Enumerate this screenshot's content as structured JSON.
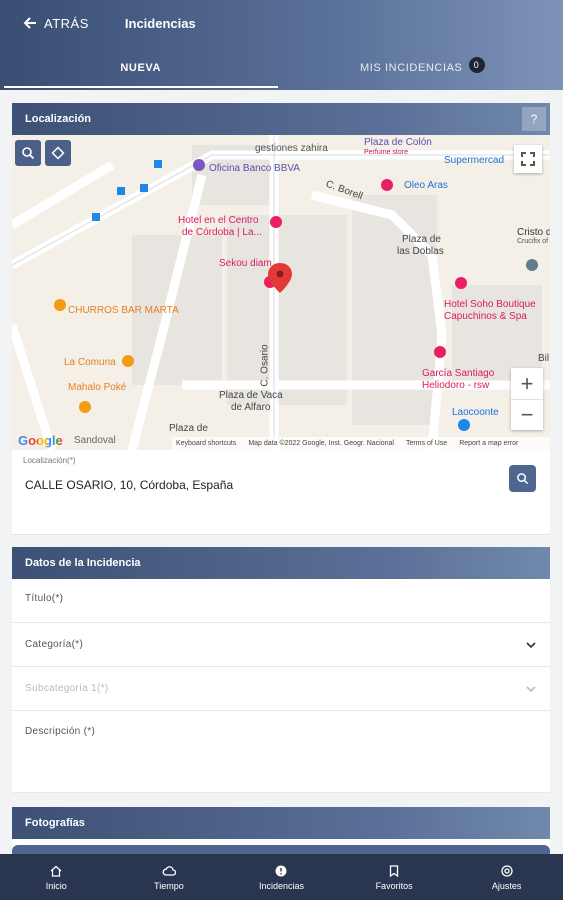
{
  "header": {
    "back_label": "ATRÁS",
    "title": "Incidencias",
    "tabs": [
      {
        "label": "NUEVA",
        "active": true
      },
      {
        "label": "MIS INCIDENCIAS",
        "badge": "0",
        "active": false
      }
    ]
  },
  "location": {
    "section_title": "Localización",
    "help_label": "?",
    "field_label": "Localización(*)",
    "field_value": "CALLE OSARIO, 10, Córdoba, España"
  },
  "map": {
    "labels": {
      "gestiones": "gestiones zahira",
      "plaza_colon": "Plaza de Colón",
      "perfume": "Perfume store",
      "supermercado": "Supermercad",
      "oficina": "Oficina Banco BBVA",
      "borell": "C. Borell",
      "oleo": "Oleo Aras",
      "hotel_centro1": "Hotel en el Centro",
      "hotel_centro2": "de Córdoba | La...",
      "plaza_doblas1": "Plaza de",
      "plaza_doblas2": "las Doblas",
      "cristo1": "Cristo d",
      "cristo2": "Crucifix of",
      "sekou": "Sekou diam",
      "churros": "CHURROS BAR MARTA",
      "hotel_soho1": "Hotel Soho Boutique",
      "hotel_soho2": "Capuchinos & Spa",
      "osario": "C. Osario",
      "comuna": "La Comuna",
      "garcia1": "García Santiago",
      "garcia2": "Heliodoro - rsw",
      "mahalo": "Mahalo Poké",
      "vaca1": "Plaza de Vaca",
      "vaca2": "de Alfaro",
      "laocoonte": "Laocoonte",
      "plaza_bottom": "Plaza de",
      "sandoval": "Sandoval",
      "bil": "Bil"
    },
    "google": "Google",
    "footer": {
      "shortcuts": "Keyboard shortcuts",
      "mapdata": "Map data ©2022 Google, Inst. Geogr. Nacional",
      "terms": "Terms of Use",
      "report": "Report a map error"
    },
    "zoom_in": "+",
    "zoom_out": "−"
  },
  "datos": {
    "section_title": "Datos de la Incidencia",
    "titulo": "Título(*)",
    "categoria": "Categoría(*)",
    "subcategoria": "Subcategoría 1(*)",
    "descripcion": "Descripción (*)"
  },
  "fotos": {
    "section_title": "Fotografías"
  },
  "nav": [
    {
      "label": "Inicio",
      "icon": "home-icon"
    },
    {
      "label": "Tiempo",
      "icon": "cloud-icon"
    },
    {
      "label": "Incidencias",
      "icon": "alert-icon"
    },
    {
      "label": "Favoritos",
      "icon": "bookmark-icon"
    },
    {
      "label": "Ajustes",
      "icon": "gear-icon"
    }
  ],
  "colors": {
    "header": "#4a5f86",
    "accent": "#4f6690",
    "nav": "#2a3650",
    "pin": "#e53935"
  }
}
